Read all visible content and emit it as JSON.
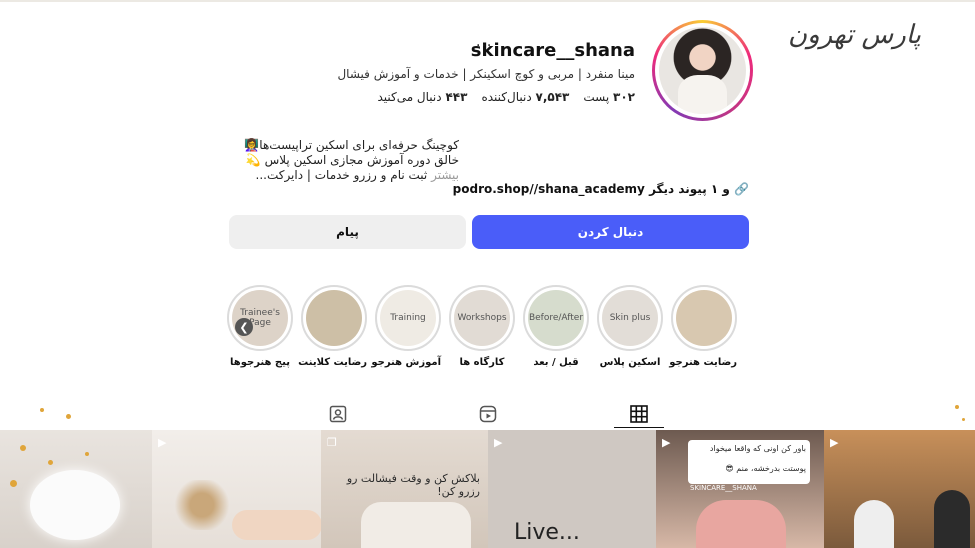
{
  "watermark": "پارس تهرون",
  "profile": {
    "username": "skincare__shana",
    "more_label": "···",
    "bio_line": "مینا منفرد | مربی و کوچ اسکینکر | خدمات و آموزش فیشال",
    "posts_count": "۳۰۲",
    "posts_label": "پست",
    "followers_count": "۷,۵۴۳",
    "followers_label": "دنبال‌کننده",
    "following_count": "۴۴۳",
    "following_label": "دنبال می‌کنید"
  },
  "description": {
    "line1": "کوچینگ حرفه‌ای برای اسکین تراپیست‌ها👩‍🏫",
    "line2": "خالق دوره آموزش مجازی اسکین پلاس 💫",
    "line3": "ثبت نام و رزرو خدمات | دایرکت...",
    "more": "بیشتر"
  },
  "link": {
    "text": "podro.shop//shana_academy",
    "suffix": "و ۱ پیوند دیگر",
    "icon": "link-icon"
  },
  "buttons": {
    "follow": "دنبال کردن",
    "message": "پیام"
  },
  "highlights": [
    {
      "label": "رضایت هنرجو",
      "inner": "",
      "color": "#d8c8b0"
    },
    {
      "label": "اسکین پلاس",
      "inner": "Skin plus",
      "color": "#e2ddd7"
    },
    {
      "label": "قبل / بعد",
      "inner": "Before/After",
      "color": "#d6dccd"
    },
    {
      "label": "کارگاه ها",
      "inner": "Workshops",
      "color": "#e1dbd4"
    },
    {
      "label": "آموزش هنرجو",
      "inner": "Training",
      "color": "#efebe4"
    },
    {
      "label": "رضایت کلاینت",
      "inner": "",
      "color": "#cdbfa6"
    },
    {
      "label": "پیج هنرجوها",
      "inner": "Trainee's Page",
      "color": "#ddd3c8"
    }
  ],
  "tabs": {
    "posts_icon": "grid-icon",
    "reels_icon": "reels-icon",
    "tagged_icon": "tagged-icon"
  },
  "posts": {
    "p3_text": "بلاکش کن و وقت فیشالت رو رزرو کن!",
    "p4_text": "Live...",
    "p5_text1": "باور کن اونی که واقعا میخواد",
    "p5_text2": "پوستت بدرخشه، منم 😎",
    "p5_caption": "SKINCARE__SHANA"
  }
}
